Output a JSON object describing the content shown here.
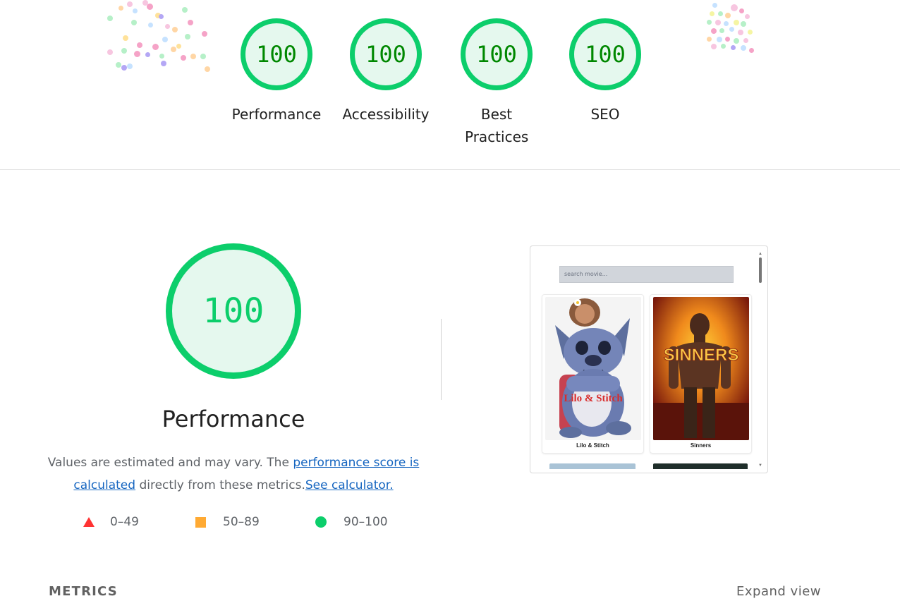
{
  "colors": {
    "pass": "#0cce6b",
    "pass_text": "#008800",
    "average": "#ffaa33",
    "fail": "#ff3333",
    "link": "#1a73e8"
  },
  "gauges": [
    {
      "score": "100",
      "label": "Performance"
    },
    {
      "score": "100",
      "label": "Accessibility"
    },
    {
      "score": "100",
      "label": "Best Practices"
    },
    {
      "score": "100",
      "label": "SEO"
    }
  ],
  "performance": {
    "score": "100",
    "title": "Performance",
    "desc_prefix": "Values are estimated and may vary. The ",
    "desc_link": "performance score is calculated",
    "desc_middle": " directly from these metrics.",
    "desc_calc_link": "See calculator."
  },
  "legend": [
    {
      "shape": "triangle",
      "range": "0–49"
    },
    {
      "shape": "square",
      "range": "50–89"
    },
    {
      "shape": "circle",
      "range": "90–100"
    }
  ],
  "screenshot": {
    "search_placeholder": "search movie...",
    "movies": [
      {
        "title": "Lilo & Stitch",
        "poster_text": "Lilo & Stitch"
      },
      {
        "title": "Sinners",
        "poster_text": "SINNERS"
      }
    ]
  },
  "metrics": {
    "heading": "METRICS",
    "expand_label": "Expand view"
  }
}
